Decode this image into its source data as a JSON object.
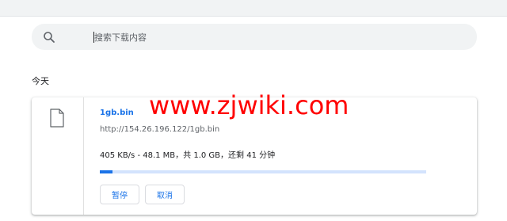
{
  "search": {
    "placeholder": "搜索下载内容",
    "icon": "search-icon"
  },
  "section": {
    "title": "今天"
  },
  "download": {
    "file_name": "1gb.bin",
    "url": "http://154.26.196.122/1gb.bin",
    "status": "405 KB/s - 48.1 MB，共 1.0 GB，还剩 41 分钟",
    "progress_percent": 4,
    "icon": "file-icon",
    "pause_label": "暂停",
    "cancel_label": "取消"
  },
  "watermark": {
    "text": "www.zjwiki.com"
  },
  "colors": {
    "accent": "#1a73e8",
    "watermark": "#ff0000"
  }
}
